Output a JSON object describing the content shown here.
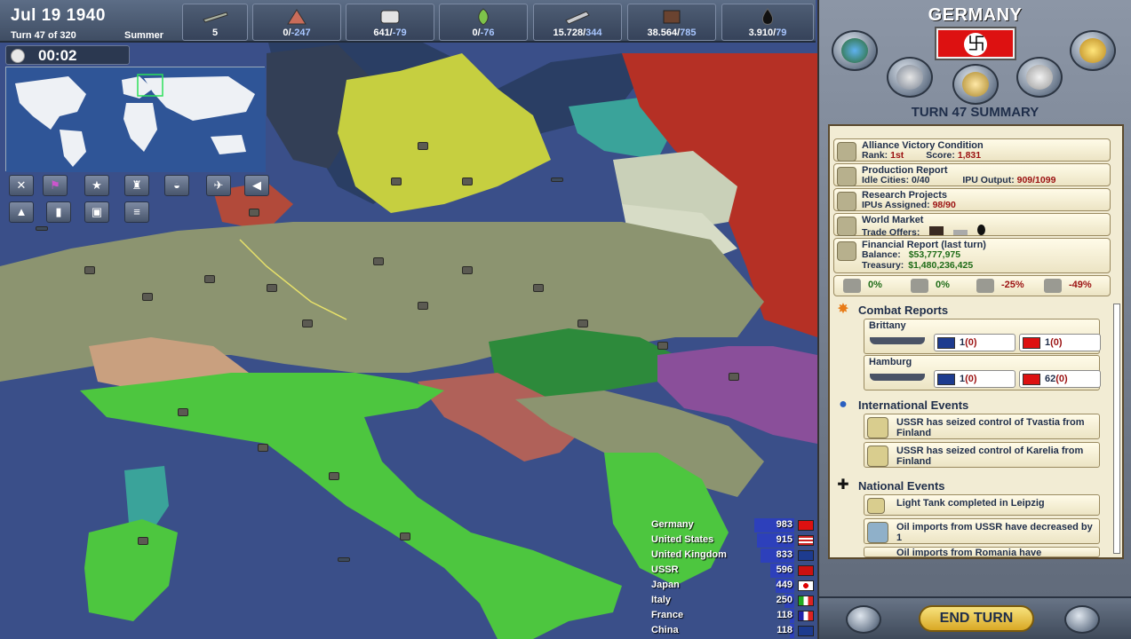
{
  "header": {
    "date": "Jul 19 1940",
    "turn": "Turn 47 of 320",
    "season": "Summer",
    "timer": "00:02"
  },
  "resources": [
    {
      "icon": "ships-icon",
      "value": "5",
      "neg": ""
    },
    {
      "icon": "troops-icon",
      "value": "0/",
      "neg": "-247"
    },
    {
      "icon": "manufacturing-icon",
      "value": "641/",
      "neg": "-79"
    },
    {
      "icon": "food-icon",
      "value": "0/",
      "neg": "-76"
    },
    {
      "icon": "steel-icon",
      "value": "15.728/",
      "neg": "344"
    },
    {
      "icon": "coal-icon",
      "value": "38.564/",
      "neg": "785"
    },
    {
      "icon": "oil-icon",
      "value": "3.910/",
      "neg": "79"
    }
  ],
  "map_tools": [
    "tool-units",
    "tool-flag",
    "tool-star",
    "tool-army",
    "tool-tank",
    "tool-plane",
    "tool-arrow",
    "tool-terrain",
    "tool-city",
    "tool-fort",
    "tool-rail"
  ],
  "legend": [
    {
      "name": "Germany",
      "value": "983",
      "flag": "germany",
      "bar": 1.0
    },
    {
      "name": "United States",
      "value": "915",
      "flag": "usa",
      "bar": 0.93
    },
    {
      "name": "United Kingdom",
      "value": "833",
      "flag": "uk",
      "bar": 0.85
    },
    {
      "name": "USSR",
      "value": "596",
      "flag": "ussr",
      "bar": 0.61
    },
    {
      "name": "Japan",
      "value": "449",
      "flag": "japan",
      "bar": 0.46
    },
    {
      "name": "Italy",
      "value": "250",
      "flag": "italy",
      "bar": 0.25
    },
    {
      "name": "France",
      "value": "118",
      "flag": "france",
      "bar": 0.12
    },
    {
      "name": "China",
      "value": "118",
      "flag": "china",
      "bar": 0.12
    }
  ],
  "panel": {
    "country": "GERMANY",
    "summary_title": "TURN 47 SUMMARY",
    "victory": {
      "title": "Alliance Victory Condition",
      "rank_label": "Rank:",
      "rank": "1st",
      "score_label": "Score:",
      "score": "1,831"
    },
    "production": {
      "title": "Production Report",
      "idle_label": "Idle Cities: 0/40",
      "ipu_label": "IPU Output:",
      "ipu": "909/1099"
    },
    "research": {
      "title": "Research Projects",
      "ipu_label": "IPUs Assigned:",
      "ipu": "98/90"
    },
    "market": {
      "title": "World Market",
      "offers_label": "Trade Offers:"
    },
    "finance": {
      "title": "Financial Report (last turn)",
      "balance_label": "Balance:",
      "balance": "$53,777,975",
      "treasury_label": "Treasury:",
      "treasury": "$1,480,236,425"
    },
    "percent_row": [
      {
        "icon": "manufacturing-icon",
        "value": "0%",
        "color": "#1f6c18"
      },
      {
        "icon": "money-icon",
        "value": "0%",
        "color": "#1f6c18"
      },
      {
        "icon": "worker-icon",
        "value": "-25%",
        "color": "#9b1111"
      },
      {
        "icon": "factory-icon",
        "value": "-49%",
        "color": "#9b1111"
      }
    ],
    "combat_title": "Combat Reports",
    "battles": [
      {
        "location": "Brittany",
        "uk": "1",
        "uk_loss": "(0)",
        "de": "1",
        "de_loss": "(0)"
      },
      {
        "location": "Hamburg",
        "uk": "1",
        "uk_loss": "(0)",
        "de": "62",
        "de_loss": "(0)"
      }
    ],
    "intl_title": "International Events",
    "intl_events": [
      "USSR has seized control of Tvastia from Finland",
      "USSR has seized control of Karelia from Finland"
    ],
    "national_title": "National Events",
    "national_events": [
      "Light Tank completed in Leipzig",
      "Oil imports from USSR have decreased by 1",
      "Oil imports from Romania have"
    ],
    "end_turn": "END TURN"
  },
  "colors": {
    "germany": "#8c9470",
    "italy": "#4dc63f",
    "finland": "#c9d13f",
    "ussr": "#b53025",
    "hungary": "#2d8a3b",
    "yugoslavia": "#b06159",
    "sea": "#3a4f89"
  }
}
